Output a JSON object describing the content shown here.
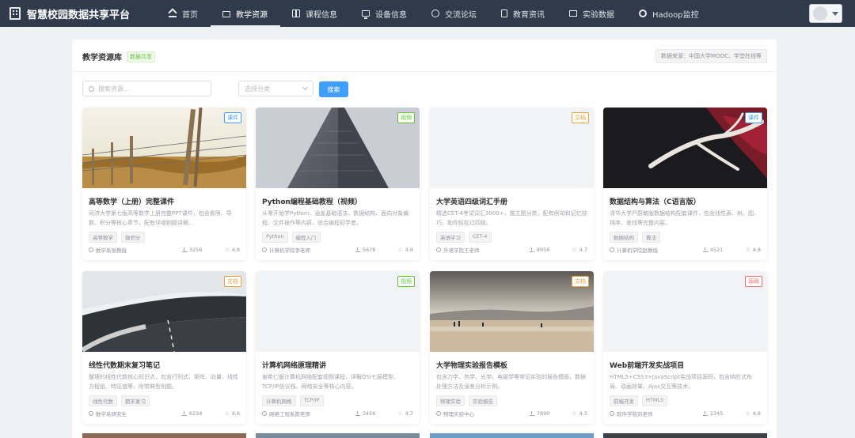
{
  "brand": {
    "title": "智慧校园数据共享平台"
  },
  "nav": [
    {
      "label": "首页",
      "icon": "home-icon",
      "active": false
    },
    {
      "label": "教学资源",
      "icon": "folder-icon",
      "active": true
    },
    {
      "label": "课程信息",
      "icon": "book-icon",
      "active": false
    },
    {
      "label": "设备信息",
      "icon": "monitor-icon",
      "active": false
    },
    {
      "label": "交流论坛",
      "icon": "chat-icon",
      "active": false
    },
    {
      "label": "教育资讯",
      "icon": "document-icon",
      "active": false
    },
    {
      "label": "实验数据",
      "icon": "data-icon",
      "active": false
    },
    {
      "label": "Hadoop监控",
      "icon": "gear-icon",
      "active": false
    }
  ],
  "panel": {
    "title": "教学资源库",
    "tag": "数据共享",
    "source": "数据来源：中国大学MOOC、学堂在线等"
  },
  "filters": {
    "search_placeholder": "搜索资源...",
    "select_placeholder": "选择分类",
    "search_button": "搜索"
  },
  "cards": [
    {
      "title": "高等数学（上册）完整课件",
      "desc": "同济大学第七版高等数学上册完整PPT课件，包含极限、导数、积分等核心章节，配有详细例题讲解…",
      "badge": "课件",
      "badge_color": "#409eff",
      "tags": [
        "高等数学",
        "微积分"
      ],
      "author": "数学系张教授",
      "downloads": "3256",
      "rating": "4.8"
    },
    {
      "title": "Python编程基础教程（视频）",
      "desc": "从零开始学Python，涵盖基础语法、数据结构、面向对象编程、文件操作等内容，适合编程初学者。",
      "badge": "视频",
      "badge_color": "#67c23a",
      "tags": [
        "Python",
        "编程入门"
      ],
      "author": "计算机学院李老师",
      "downloads": "5678",
      "rating": "4.9"
    },
    {
      "title": "大学英语四级词汇手册",
      "desc": "精选CET-4考试词汇3000+，按主题分类，配有例句和记忆技巧，助你轻松过四级。",
      "badge": "文档",
      "badge_color": "#e6a23c",
      "tags": [
        "英语学习",
        "CET-4"
      ],
      "author": "外语学院王老师",
      "downloads": "8956",
      "rating": "4.7"
    },
    {
      "title": "数据结构与算法（C语言版）",
      "desc": "清华大学严蔚敏版数据结构配套课件，包含线性表、树、图、排序、查找等完整内容。",
      "badge": "课件",
      "badge_color": "#409eff",
      "tags": [
        "数据结构",
        "算法"
      ],
      "author": "计算机学院赵教授",
      "downloads": "4521",
      "rating": "4.8"
    },
    {
      "title": "线性代数期末复习笔记",
      "desc": "整理的线性代数核心知识点，包含行列式、矩阵、向量、线性方程组、特征值等，附带典型例题。",
      "badge": "文档",
      "badge_color": "#e6a23c",
      "tags": [
        "线性代数",
        "期末复习"
      ],
      "author": "数学系研究生",
      "downloads": "6234",
      "rating": "4.6"
    },
    {
      "title": "计算机网络原理精讲",
      "desc": "谢希仁版计算机网络配套视频课程，详解OSI七层模型、TCP/IP协议栈、网络安全等核心内容。",
      "badge": "视频",
      "badge_color": "#67c23a",
      "tags": [
        "计算机网络",
        "TCP/IP"
      ],
      "author": "网络工程系陈老师",
      "downloads": "3456",
      "rating": "4.7"
    },
    {
      "title": "大学物理实验报告模板",
      "desc": "包含力学、热学、光学、电磁学等常见实验的报告模板，数据处理方法及误差分析示例。",
      "badge": "文档",
      "badge_color": "#e6a23c",
      "tags": [
        "物理实验",
        "实验报告"
      ],
      "author": "物理实验中心",
      "downloads": "7890",
      "rating": "4.5"
    },
    {
      "title": "Web前端开发实战项目",
      "desc": "HTML5+CSS3+JavaScript实战项目源码，包含响应式布局、动画效果、Ajax交互等技术。",
      "badge": "源码",
      "badge_color": "#f56c6c",
      "tags": [
        "前端开发",
        "HTML5"
      ],
      "author": "软件学院刘老师",
      "downloads": "2345",
      "rating": "4.8"
    }
  ]
}
